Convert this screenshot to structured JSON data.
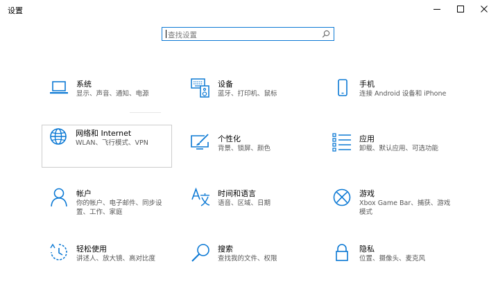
{
  "window": {
    "title": "设置"
  },
  "search": {
    "placeholder": "查找设置"
  },
  "tiles": [
    {
      "title": "系统",
      "desc": "显示、声音、通知、电源",
      "icon": "laptop-icon"
    },
    {
      "title": "设备",
      "desc": "蓝牙、打印机、鼠标",
      "icon": "devices-icon"
    },
    {
      "title": "手机",
      "desc": "连接 Android 设备和 iPhone",
      "icon": "phone-icon"
    },
    {
      "title": "网络和 Internet",
      "desc": "WLAN、飞行模式、VPN",
      "icon": "globe-icon"
    },
    {
      "title": "个性化",
      "desc": "背景、锁屏、颜色",
      "icon": "personalization-icon"
    },
    {
      "title": "应用",
      "desc": "卸载、默认应用、可选功能",
      "icon": "apps-list-icon"
    },
    {
      "title": "帐户",
      "desc": "你的帐户、电子邮件、同步设置、工作、家庭",
      "icon": "person-icon"
    },
    {
      "title": "时间和语言",
      "desc": "语音、区域、日期",
      "icon": "time-language-icon"
    },
    {
      "title": "游戏",
      "desc": "Xbox Game Bar、捕获、游戏模式",
      "icon": "xbox-icon"
    },
    {
      "title": "轻松使用",
      "desc": "讲述人、放大镜、高对比度",
      "icon": "ease-of-access-icon"
    },
    {
      "title": "搜索",
      "desc": "查找我的文件、权限",
      "icon": "search-icon"
    },
    {
      "title": "隐私",
      "desc": "位置、摄像头、麦克风",
      "icon": "lock-icon"
    }
  ],
  "colors": {
    "accent": "#0a78d4",
    "text": "#000000",
    "subtext": "#555555"
  }
}
